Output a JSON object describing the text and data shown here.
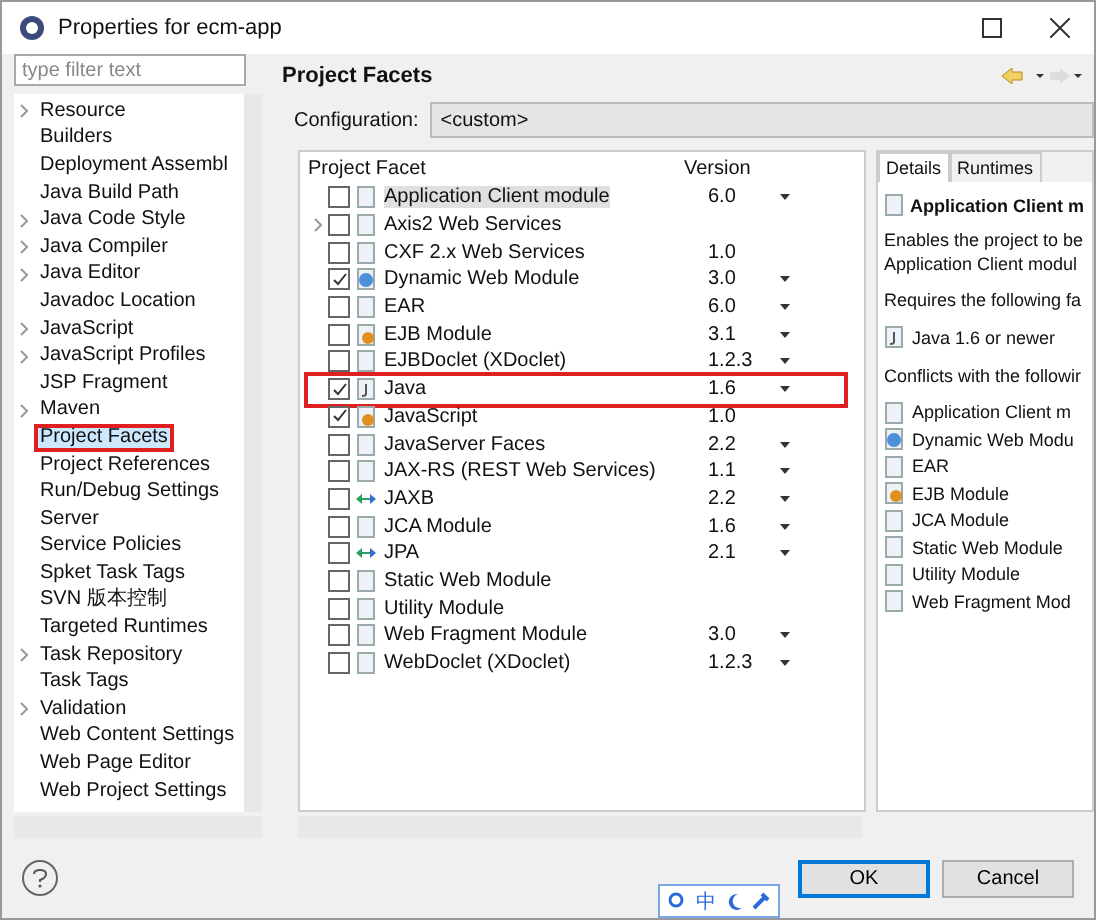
{
  "window": {
    "title": "Properties for ecm-app"
  },
  "filter": {
    "placeholder": "type filter text"
  },
  "tree": [
    {
      "label": "Resource",
      "expandable": true,
      "selected": false,
      "highlighted": false
    },
    {
      "label": "Builders",
      "expandable": false,
      "selected": false,
      "highlighted": false
    },
    {
      "label": "Deployment Assembl",
      "expandable": false,
      "selected": false,
      "highlighted": false
    },
    {
      "label": "Java Build Path",
      "expandable": false,
      "selected": false,
      "highlighted": false
    },
    {
      "label": "Java Code Style",
      "expandable": true,
      "selected": false,
      "highlighted": false
    },
    {
      "label": "Java Compiler",
      "expandable": true,
      "selected": false,
      "highlighted": false
    },
    {
      "label": "Java Editor",
      "expandable": true,
      "selected": false,
      "highlighted": false
    },
    {
      "label": "Javadoc Location",
      "expandable": false,
      "selected": false,
      "highlighted": false
    },
    {
      "label": "JavaScript",
      "expandable": true,
      "selected": false,
      "highlighted": false
    },
    {
      "label": "JavaScript Profiles",
      "expandable": true,
      "selected": false,
      "highlighted": false
    },
    {
      "label": "JSP Fragment",
      "expandable": false,
      "selected": false,
      "highlighted": false
    },
    {
      "label": "Maven",
      "expandable": true,
      "selected": false,
      "highlighted": false
    },
    {
      "label": "Project Facets",
      "expandable": false,
      "selected": true,
      "highlighted": true
    },
    {
      "label": "Project References",
      "expandable": false,
      "selected": false,
      "highlighted": false
    },
    {
      "label": "Run/Debug Settings",
      "expandable": false,
      "selected": false,
      "highlighted": false
    },
    {
      "label": "Server",
      "expandable": false,
      "selected": false,
      "highlighted": false
    },
    {
      "label": "Service Policies",
      "expandable": false,
      "selected": false,
      "highlighted": false
    },
    {
      "label": "Spket Task Tags",
      "expandable": false,
      "selected": false,
      "highlighted": false
    },
    {
      "label": "SVN 版本控制",
      "expandable": false,
      "selected": false,
      "highlighted": false
    },
    {
      "label": "Targeted Runtimes",
      "expandable": false,
      "selected": false,
      "highlighted": false
    },
    {
      "label": "Task Repository",
      "expandable": true,
      "selected": false,
      "highlighted": false
    },
    {
      "label": "Task Tags",
      "expandable": false,
      "selected": false,
      "highlighted": false
    },
    {
      "label": "Validation",
      "expandable": true,
      "selected": false,
      "highlighted": false
    },
    {
      "label": "Web Content Settings",
      "expandable": false,
      "selected": false,
      "highlighted": false
    },
    {
      "label": "Web Page Editor",
      "expandable": false,
      "selected": false,
      "highlighted": false
    },
    {
      "label": "Web Project Settings",
      "expandable": false,
      "selected": false,
      "highlighted": false
    }
  ],
  "page": {
    "title": "Project Facets",
    "configuration_label": "Configuration:",
    "configuration_value": "<custom>"
  },
  "facets": {
    "columns": [
      "Project Facet",
      "Version"
    ],
    "rows": [
      {
        "name": "Application Client module",
        "kind": "file",
        "checked": false,
        "version": "6.0",
        "dropdown": true,
        "expandable": false,
        "selected": true,
        "highlighted": false
      },
      {
        "name": "Axis2 Web Services",
        "kind": "file",
        "checked": false,
        "dropdown": false,
        "expandable": true,
        "selected": false,
        "highlighted": false
      },
      {
        "name": "CXF 2.x Web Services",
        "kind": "file",
        "checked": false,
        "version": "1.0",
        "dropdown": false,
        "expandable": false,
        "selected": false,
        "highlighted": false
      },
      {
        "name": "Dynamic Web Module",
        "kind": "web",
        "checked": true,
        "version": "3.0",
        "dropdown": true,
        "expandable": false,
        "selected": false,
        "highlighted": false
      },
      {
        "name": "EAR",
        "kind": "file",
        "checked": false,
        "version": "6.0",
        "dropdown": true,
        "expandable": false,
        "selected": false,
        "highlighted": false
      },
      {
        "name": "EJB Module",
        "kind": "ejb",
        "checked": false,
        "version": "3.1",
        "dropdown": true,
        "expandable": false,
        "selected": false,
        "highlighted": false
      },
      {
        "name": "EJBDoclet (XDoclet)",
        "kind": "file",
        "checked": false,
        "version": "1.2.3",
        "dropdown": true,
        "expandable": false,
        "selected": false,
        "highlighted": false
      },
      {
        "name": "Java",
        "kind": "java",
        "checked": true,
        "version": "1.6",
        "dropdown": true,
        "expandable": false,
        "selected": false,
        "highlighted": true
      },
      {
        "name": "JavaScript",
        "kind": "ejb",
        "checked": true,
        "version": "1.0",
        "dropdown": false,
        "expandable": false,
        "selected": false,
        "highlighted": false
      },
      {
        "name": "JavaServer Faces",
        "kind": "file",
        "checked": false,
        "version": "2.2",
        "dropdown": true,
        "expandable": false,
        "selected": false,
        "highlighted": false
      },
      {
        "name": "JAX-RS (REST Web Services)",
        "kind": "file",
        "checked": false,
        "version": "1.1",
        "dropdown": true,
        "expandable": false,
        "selected": false,
        "highlighted": false
      },
      {
        "name": "JAXB",
        "kind": "bind",
        "checked": false,
        "version": "2.2",
        "dropdown": true,
        "expandable": false,
        "selected": false,
        "highlighted": false
      },
      {
        "name": "JCA Module",
        "kind": "file",
        "checked": false,
        "version": "1.6",
        "dropdown": true,
        "expandable": false,
        "selected": false,
        "highlighted": false
      },
      {
        "name": "JPA",
        "kind": "bind",
        "checked": false,
        "version": "2.1",
        "dropdown": true,
        "expandable": false,
        "selected": false,
        "highlighted": false
      },
      {
        "name": "Static Web Module",
        "kind": "file",
        "checked": false,
        "dropdown": false,
        "expandable": false,
        "selected": false,
        "highlighted": false
      },
      {
        "name": "Utility Module",
        "kind": "file",
        "checked": false,
        "dropdown": false,
        "expandable": false,
        "selected": false,
        "highlighted": false
      },
      {
        "name": "Web Fragment Module",
        "kind": "file",
        "checked": false,
        "version": "3.0",
        "dropdown": true,
        "expandable": false,
        "selected": false,
        "highlighted": false
      },
      {
        "name": "WebDoclet (XDoclet)",
        "kind": "file",
        "checked": false,
        "version": "1.2.3",
        "dropdown": true,
        "expandable": false,
        "selected": false,
        "highlighted": false
      }
    ]
  },
  "details": {
    "tabs": [
      {
        "label": "Details",
        "selected": true
      },
      {
        "label": "Runtimes",
        "selected": false
      }
    ],
    "title": "Application Client m",
    "description": "Enables the project to be Application Client modul",
    "requires_label": "Requires the following fa",
    "requires": [
      {
        "name": "Java 1.6 or newer",
        "kind": "java"
      }
    ],
    "conflicts_label": "Conflicts with the followir",
    "conflicts": [
      {
        "name": "Application Client m",
        "kind": "file"
      },
      {
        "name": "Dynamic Web Modu",
        "kind": "web"
      },
      {
        "name": "EAR",
        "kind": "file"
      },
      {
        "name": "EJB Module",
        "kind": "ejb"
      },
      {
        "name": "JCA Module",
        "kind": "file"
      },
      {
        "name": "Static Web Module",
        "kind": "file"
      },
      {
        "name": "Utility Module",
        "kind": "file"
      },
      {
        "name": "Web Fragment Mod",
        "kind": "file"
      }
    ]
  },
  "buttons": [
    {
      "label": "OK",
      "default": true
    },
    {
      "label": "Cancel",
      "default": false
    }
  ],
  "ime": {
    "label": "中"
  }
}
